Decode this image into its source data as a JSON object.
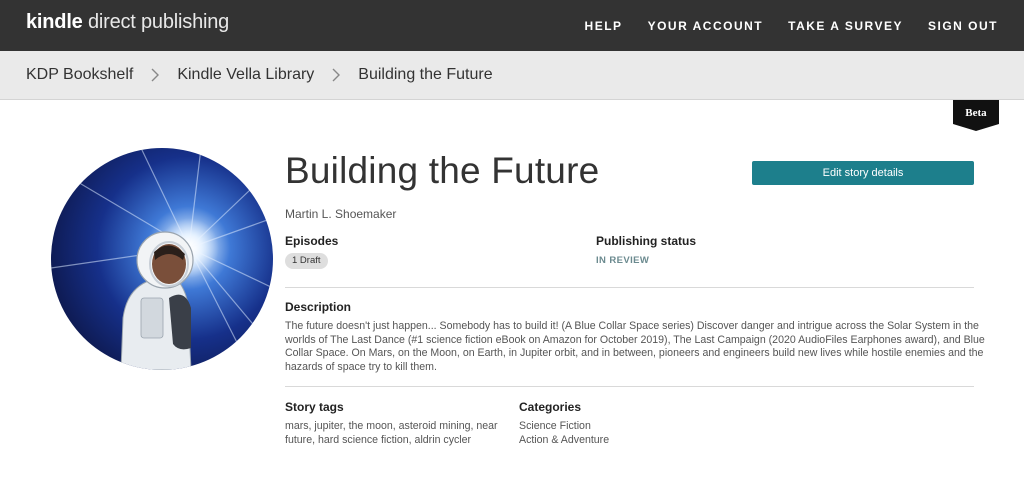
{
  "header": {
    "logo_kindle": "kindle",
    "logo_rest": " direct publishing",
    "nav": [
      {
        "label": "HELP"
      },
      {
        "label": "YOUR ACCOUNT"
      },
      {
        "label": "TAKE A SURVEY"
      },
      {
        "label": "SIGN OUT"
      }
    ]
  },
  "breadcrumb": {
    "items": [
      {
        "label": "KDP Bookshelf"
      },
      {
        "label": "Kindle Vella Library"
      },
      {
        "label": "Building the Future"
      }
    ]
  },
  "beta_label": "Beta",
  "story": {
    "title": "Building the Future",
    "author": "Martin L. Shoemaker",
    "edit_button_label": "Edit story details",
    "episodes_label": "Episodes",
    "episodes_badge": "1 Draft",
    "publishing_status_label": "Publishing status",
    "publishing_status": "IN REVIEW",
    "description_label": "Description",
    "description": "The future doesn't just happen... Somebody has to build it! (A Blue Collar Space series) Discover danger and intrigue across the Solar System in the worlds of The Last Dance (#1 science fiction eBook on Amazon for October 2019), The Last Campaign (2020 AudioFiles Earphones award), and Blue Collar Space. On Mars, on the Moon, on Earth, in Jupiter orbit, and in between, pioneers and engineers build new lives while hostile enemies and the hazards of space try to kill them.",
    "tags_label": "Story tags",
    "tags": "mars, jupiter, the moon, asteroid mining, near future, hard science fiction, aldrin cycler",
    "categories_label": "Categories",
    "categories": [
      "Science Fiction",
      "Action & Adventure"
    ]
  },
  "colors": {
    "topbar": "#333333",
    "accent_button": "#1d7f8c",
    "status_text": "#6b8a8f"
  },
  "icons": {
    "breadcrumb_separator": "chevron-right-icon",
    "cover": "astronaut-cover-art"
  }
}
